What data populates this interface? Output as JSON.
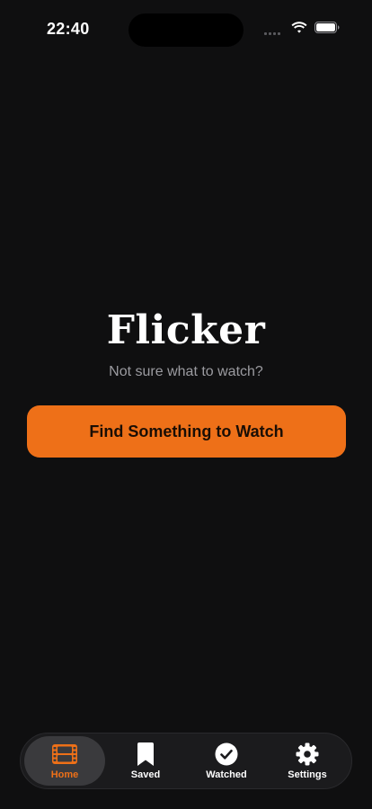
{
  "status_bar": {
    "time": "22:40"
  },
  "hero": {
    "title": "Flicker",
    "subtitle": "Not sure what to watch?",
    "cta_label": "Find Something to Watch"
  },
  "tab_bar": {
    "active_index": 0,
    "tabs": [
      {
        "label": "Home",
        "icon": "film-icon"
      },
      {
        "label": "Saved",
        "icon": "bookmark-icon"
      },
      {
        "label": "Watched",
        "icon": "checkmark-circle-icon"
      },
      {
        "label": "Settings",
        "icon": "gear-icon"
      }
    ]
  },
  "colors": {
    "background": "#0f0f10",
    "accent": "#ee7018",
    "subtitle": "#9b9ba0",
    "tab_bar_bg": "#1b1b1d",
    "tab_active_bg": "#3a3a3d"
  }
}
